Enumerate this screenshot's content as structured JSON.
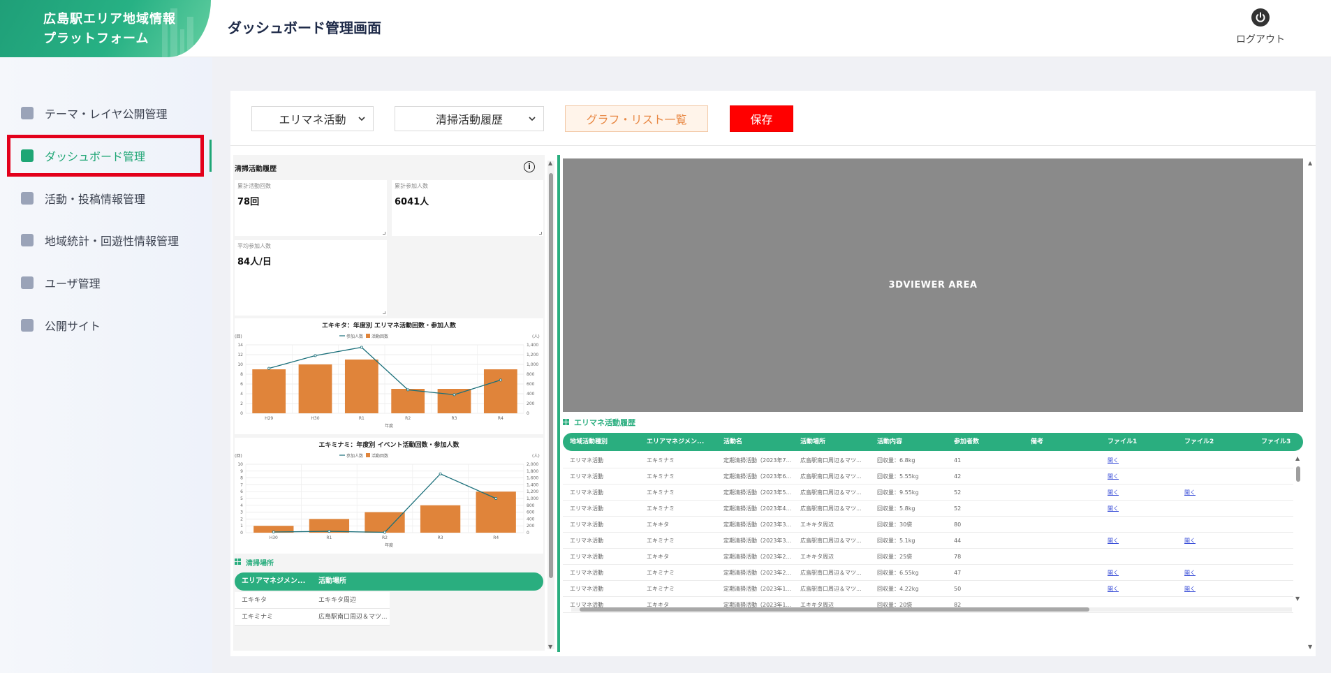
{
  "logo": {
    "line1": "広島駅エリア地域情報",
    "line2": "プラットフォーム"
  },
  "header": {
    "title": "ダッシュボード管理画面",
    "logout_label": "ログアウト"
  },
  "sidebar": {
    "items": [
      {
        "label": "テーマ・レイヤ公開管理",
        "icon": "layer-icon"
      },
      {
        "label": "ダッシュボード管理",
        "icon": "dashboard-icon",
        "active": true
      },
      {
        "label": "活動・投稿情報管理",
        "icon": "inbox-icon"
      },
      {
        "label": "地域統計・回遊性情報管理",
        "icon": "calendar-icon"
      },
      {
        "label": "ユーザ管理",
        "icon": "user-icon"
      },
      {
        "label": "公開サイト",
        "icon": "monitor-icon"
      }
    ]
  },
  "toolbar": {
    "select1": "エリマネ活動",
    "select2": "清掃活動履歴",
    "list_button": "グラフ・リスト一覧",
    "save_button": "保存"
  },
  "left": {
    "title": "清掃活動履歴",
    "kpis": [
      {
        "caption": "累計活動回数",
        "value": "78回"
      },
      {
        "caption": "累計参加人数",
        "value": "6041人"
      },
      {
        "caption": "平均参加人数",
        "value": "84人/日"
      }
    ],
    "place_title": "清掃場所",
    "place_table": {
      "headers": [
        "エリアマネジメン...",
        "活動場所"
      ],
      "rows": [
        [
          "エキキタ",
          "エキキタ周辺"
        ],
        [
          "エキミナミ",
          "広島駅南口周辺＆マツ..."
        ]
      ]
    }
  },
  "chart_data": [
    {
      "type": "bar",
      "title": "エキキタ：年度別 エリマネ活動回数・参加人数",
      "categories": [
        "H29",
        "H30",
        "R1",
        "R2",
        "R3",
        "R4"
      ],
      "xlabel": "年度",
      "ylabel": "(回)",
      "y2label": "(人)",
      "ylim": [
        0,
        14
      ],
      "y2lim": [
        0,
        1400
      ],
      "yticks": [
        0,
        2,
        4,
        6,
        8,
        10,
        12,
        14
      ],
      "y2ticks": [
        "0",
        "200",
        "400",
        "600",
        "800",
        "1,000",
        "1,200",
        "1,400"
      ],
      "legend": [
        "参加人数",
        "活動回数"
      ],
      "series": [
        {
          "name": "活動回数",
          "kind": "bar",
          "values": [
            9,
            10,
            11,
            5,
            5,
            9
          ]
        },
        {
          "name": "参加人数",
          "kind": "line",
          "axis": "right",
          "values": [
            920,
            1180,
            1350,
            480,
            380,
            680
          ]
        }
      ]
    },
    {
      "type": "bar",
      "title": "エキミナミ：年度別 イベント活動回数・参加人数",
      "categories": [
        "H30",
        "R1",
        "R2",
        "R3",
        "R4"
      ],
      "xlabel": "年度",
      "ylabel": "(回)",
      "y2label": "(人)",
      "ylim": [
        0,
        10
      ],
      "y2lim": [
        0,
        2000
      ],
      "yticks": [
        0,
        1,
        2,
        3,
        4,
        5,
        6,
        7,
        8,
        9,
        10
      ],
      "y2ticks": [
        "0",
        "200",
        "400",
        "600",
        "800",
        "1,000",
        "1,200",
        "1,400",
        "1,600",
        "1,800",
        "2,000"
      ],
      "legend": [
        "参加人数",
        "活動回数"
      ],
      "series": [
        {
          "name": "活動回数",
          "kind": "bar",
          "values": [
            1,
            2,
            3,
            4,
            6
          ]
        },
        {
          "name": "参加人数",
          "kind": "line",
          "axis": "right",
          "values": [
            20,
            40,
            10,
            1720,
            1000
          ]
        }
      ]
    }
  ],
  "viewer": {
    "label": "3DVIEWER AREA"
  },
  "activity": {
    "title": "エリマネ活動履歴",
    "headers": [
      "地域活動種別",
      "エリアマネジメン...",
      "活動名",
      "活動場所",
      "活動内容",
      "参加者数",
      "備考",
      "ファイル1",
      "ファイル2",
      "ファイル3"
    ],
    "link_text": "開く",
    "rows": [
      {
        "cells": [
          "エリマネ活動",
          "エキミナミ",
          "定期清掃活動（2023年7...",
          "広島駅南口周辺＆マツ...",
          "回収量：6.8kg",
          "41",
          ""
        ],
        "f1": true,
        "f2": false
      },
      {
        "cells": [
          "エリマネ活動",
          "エキミナミ",
          "定期清掃活動（2023年6...",
          "広島駅南口周辺＆マツ...",
          "回収量：5.55kg",
          "42",
          ""
        ],
        "f1": true,
        "f2": false
      },
      {
        "cells": [
          "エリマネ活動",
          "エキミナミ",
          "定期清掃活動（2023年5...",
          "広島駅南口周辺＆マツ...",
          "回収量：9.55kg",
          "52",
          ""
        ],
        "f1": true,
        "f2": true
      },
      {
        "cells": [
          "エリマネ活動",
          "エキミナミ",
          "定期清掃活動（2023年4...",
          "広島駅南口周辺＆マツ...",
          "回収量：5.8kg",
          "52",
          ""
        ],
        "f1": true,
        "f2": false
      },
      {
        "cells": [
          "エリマネ活動",
          "エキキタ",
          "定期清掃活動（2023年3...",
          "エキキタ周辺",
          "回収量：30袋",
          "80",
          ""
        ],
        "f1": false,
        "f2": false
      },
      {
        "cells": [
          "エリマネ活動",
          "エキミナミ",
          "定期清掃活動（2023年3...",
          "広島駅南口周辺＆マツ...",
          "回収量：5.1kg",
          "44",
          ""
        ],
        "f1": true,
        "f2": true
      },
      {
        "cells": [
          "エリマネ活動",
          "エキキタ",
          "定期清掃活動（2023年2...",
          "エキキタ周辺",
          "回収量：25袋",
          "78",
          ""
        ],
        "f1": false,
        "f2": false
      },
      {
        "cells": [
          "エリマネ活動",
          "エキミナミ",
          "定期清掃活動（2023年2...",
          "広島駅南口周辺＆マツ...",
          "回収量：6.55kg",
          "47",
          ""
        ],
        "f1": true,
        "f2": true
      },
      {
        "cells": [
          "エリマネ活動",
          "エキミナミ",
          "定期清掃活動（2023年1...",
          "広島駅南口周辺＆マツ...",
          "回収量：4.22kg",
          "50",
          ""
        ],
        "f1": true,
        "f2": true
      },
      {
        "cells": [
          "エリマネ活動",
          "エキキタ",
          "定期清掃活動（2023年1...",
          "エキキタ周辺",
          "回収量：20袋",
          "82",
          ""
        ],
        "f1": false,
        "f2": false
      }
    ]
  },
  "colors": {
    "brand": "#27b184",
    "bar": "#e0843a",
    "line": "#1a6f7a",
    "save": "#ff0000",
    "highlight": "#e3001b"
  }
}
